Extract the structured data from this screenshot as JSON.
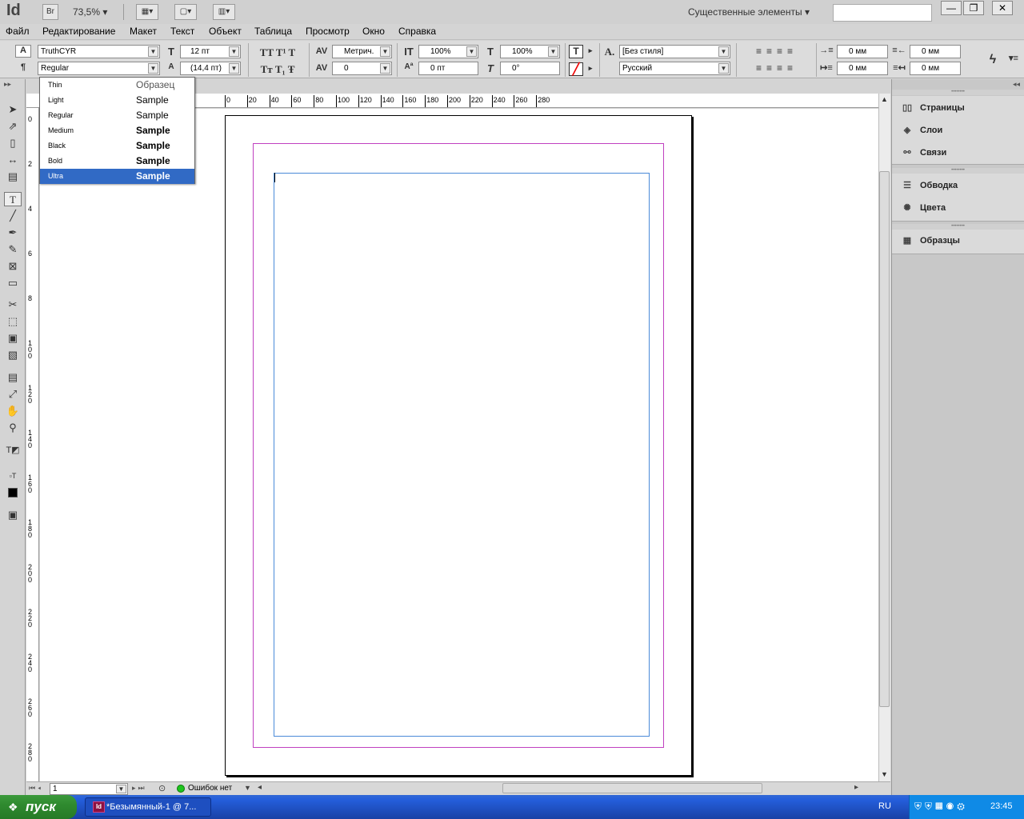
{
  "app": {
    "logo": "Id",
    "bridge": "Br",
    "zoom": "73,5%",
    "workspace": "Существенные элементы"
  },
  "menu": [
    "Файл",
    "Редактирование",
    "Макет",
    "Текст",
    "Объект",
    "Таблица",
    "Просмотр",
    "Окно",
    "Справка"
  ],
  "control": {
    "font_family": "TruthCYR",
    "font_style": "Regular",
    "font_size": "12 пт",
    "leading": "(14,4 пт)",
    "kerning": "Метрич.",
    "tracking": "0",
    "vscale": "100%",
    "hscale": "100%",
    "baseline": "0 пт",
    "skew": "0°",
    "char_style": "[Без стиля]",
    "language": "Русский",
    "indent_left": "0 мм",
    "indent_right": "0 мм",
    "indent_first": "0 мм",
    "indent_last": "0 мм"
  },
  "font_dropdown": [
    {
      "name": "Thin",
      "sample": "Образец"
    },
    {
      "name": "Light",
      "sample": "Sample"
    },
    {
      "name": "Regular",
      "sample": "Sample"
    },
    {
      "name": "Medium",
      "sample": "Sample"
    },
    {
      "name": "Black",
      "sample": "Sample"
    },
    {
      "name": "Bold",
      "sample": "Sample"
    },
    {
      "name": "Ultra",
      "sample": "Sample"
    }
  ],
  "ruler_top": [
    "0",
    "20",
    "40",
    "60",
    "80",
    "100",
    "120",
    "140",
    "160",
    "180",
    "200",
    "220",
    "240",
    "260",
    "280"
  ],
  "ruler_left": [
    "0",
    "2",
    "4",
    "6",
    "8",
    "100",
    "120",
    "140",
    "160",
    "180",
    "200",
    "220",
    "240",
    "260",
    "280"
  ],
  "panels": {
    "pages": "Страницы",
    "layers": "Слои",
    "links": "Связи",
    "stroke": "Обводка",
    "colors": "Цвета",
    "swatches": "Образцы"
  },
  "status": {
    "page": "1",
    "errors": "Ошибок нет"
  },
  "taskbar": {
    "start": "пуск",
    "task": "*Безымянный-1 @ 7...",
    "lang": "RU",
    "time": "23:45"
  }
}
